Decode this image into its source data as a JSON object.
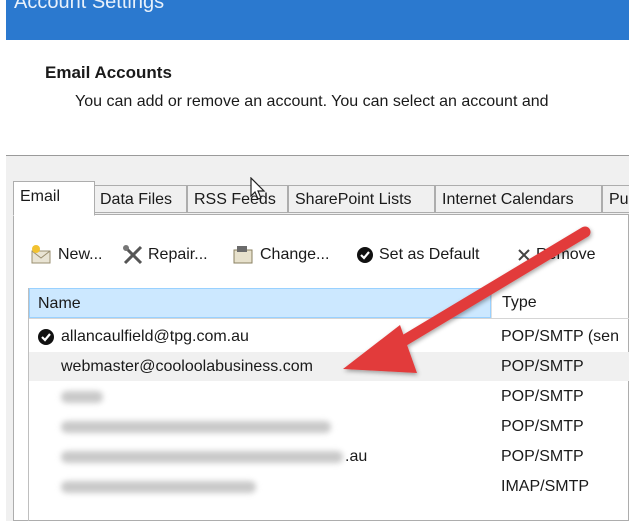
{
  "window": {
    "title": "Account Settings"
  },
  "section": {
    "heading": "Email Accounts",
    "description": "You can add or remove an account. You can select an account and"
  },
  "tabs": [
    {
      "label": "Email",
      "active": true
    },
    {
      "label": "Data Files"
    },
    {
      "label": "RSS Feeds"
    },
    {
      "label": "SharePoint Lists"
    },
    {
      "label": "Internet Calendars"
    },
    {
      "label": "Pu"
    }
  ],
  "toolbar": {
    "new": "New...",
    "repair": "Repair...",
    "change": "Change...",
    "set_default": "Set as Default",
    "remove": "Remove"
  },
  "list": {
    "columns": {
      "name": "Name",
      "type": "Type"
    },
    "rows": [
      {
        "name": "allancaulfield@tpg.com.au",
        "type": "POP/SMTP (sen",
        "default": true
      },
      {
        "name": "webmaster@cooloolabusiness.com",
        "type": "POP/SMTP",
        "selected": true
      },
      {
        "name": "",
        "type": "POP/SMTP"
      },
      {
        "name": "",
        "type": "POP/SMTP"
      },
      {
        "name": ".au",
        "type": "POP/SMTP"
      },
      {
        "name": "",
        "type": "IMAP/SMTP"
      }
    ]
  },
  "colors": {
    "titlebar": "#2b79cf",
    "header_selected": "#cce8ff",
    "arrow": "#e23b3b"
  }
}
